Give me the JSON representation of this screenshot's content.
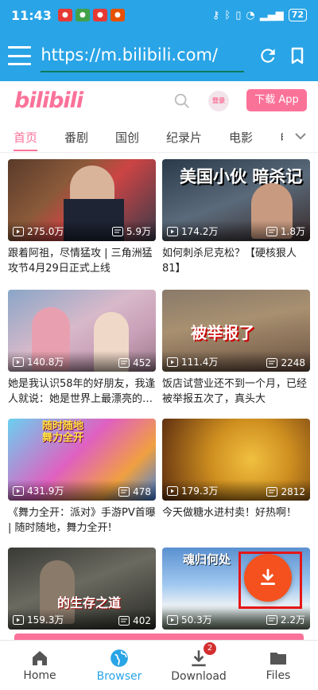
{
  "status": {
    "time": "11:43",
    "battery": "72"
  },
  "browser": {
    "url": "https://m.bilibili.com/"
  },
  "site": {
    "logo": "bilibili",
    "login": "登录",
    "download_app": "下载 App"
  },
  "tabs": [
    "首页",
    "番剧",
    "国创",
    "纪录片",
    "电影",
    "电"
  ],
  "videos": [
    {
      "views": "275.0万",
      "comments": "5.9万",
      "title": "跟着阿祖，尽情猛攻 | 三角洲猛攻节4月29日正式上线",
      "caption": ""
    },
    {
      "views": "174.2万",
      "comments": "1.8万",
      "title": "如何刺杀尼克松？【硬核狠人81】",
      "caption": "美国小伙 暗杀记"
    },
    {
      "views": "140.8万",
      "comments": "452",
      "title": "她是我认识58年的好朋友，我逢人就说：她是世界上最漂亮的…",
      "caption": ""
    },
    {
      "views": "111.4万",
      "comments": "2248",
      "title": "饭店试营业还不到一个月，已经被举报五次了，真头大",
      "caption": "被举报了"
    },
    {
      "views": "431.9万",
      "comments": "478",
      "title": "《舞力全开：派对》手游PV首曝 | 随时随地，舞力全开!",
      "caption": "随时随地 舞力全开"
    },
    {
      "views": "179.3万",
      "comments": "2812",
      "title": "今天做糖水进村卖！好热啊！",
      "caption": ""
    },
    {
      "views": "159.3万",
      "comments": "402",
      "title": "",
      "caption": "的生存之道"
    },
    {
      "views": "50.3万",
      "comments": "2.2万",
      "title": "",
      "caption": "魂归何处"
    }
  ],
  "nav": {
    "home": "Home",
    "browser": "Browser",
    "download": "Download",
    "files": "Files",
    "badge": "2"
  },
  "colors": {
    "accent": "#29a4e6",
    "bili_pink": "#fb7299",
    "fab": "#f4511e"
  }
}
